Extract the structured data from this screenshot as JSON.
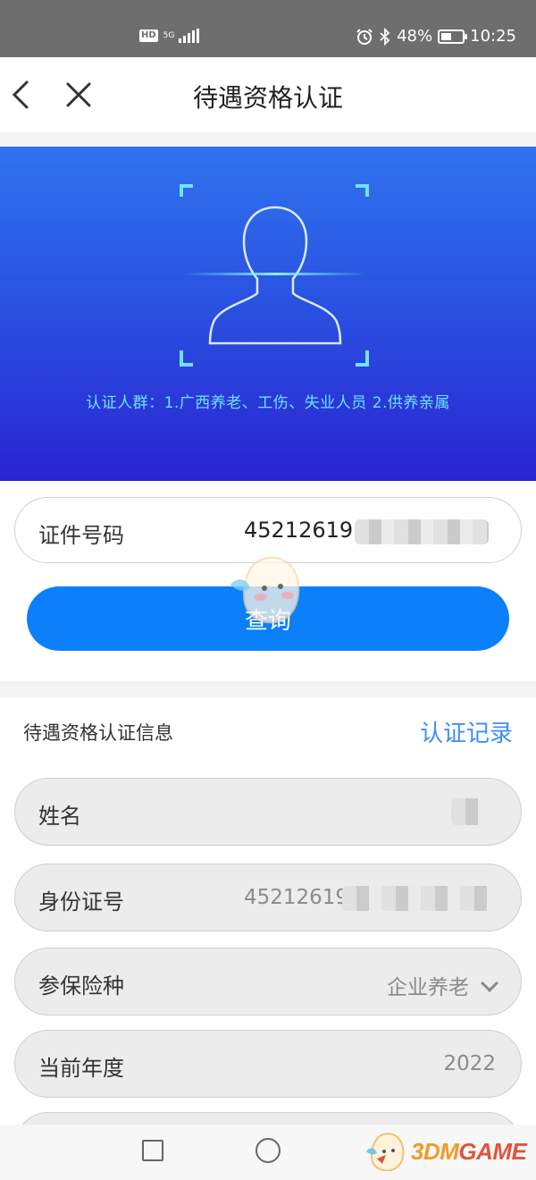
{
  "statusbar": {
    "hd": "HD",
    "net_top": "5G",
    "net_bottom": "ıl",
    "battery_text": "48%",
    "battery_level": 0.48,
    "time": "10:25",
    "icons": [
      "alarm-icon",
      "bluetooth-icon",
      "battery-icon",
      "signal-icon"
    ]
  },
  "navbar": {
    "title": "待遇资格认证",
    "back_icon": "chevron-left-icon",
    "close_icon": "close-icon"
  },
  "banner": {
    "text": "认证人群：1.广西养老、工伤、失业人员    2.供养亲属",
    "icon": "face-scan-icon"
  },
  "query": {
    "id_label": "证件号码",
    "id_value_visible": "45212619",
    "button_label": "查询"
  },
  "info": {
    "section_title": "待遇资格认证信息",
    "record_link": "认证记录",
    "fields": [
      {
        "label": "姓名",
        "value": ""
      },
      {
        "label": "身份证号",
        "value": "45212619"
      },
      {
        "label": "参保险种",
        "value": "企业养老"
      },
      {
        "label": "当前年度",
        "value": "2022"
      }
    ]
  },
  "bottom_nav": {
    "icons": [
      "recent-apps-square-icon",
      "home-circle-icon"
    ]
  },
  "watermark": {
    "prefix": "3DM",
    "suffix": "GAME"
  },
  "colors": {
    "primary": "#0c7ffa",
    "link": "#3c8ff5",
    "banner_top": "#2f73ee",
    "banner_bottom": "#2a24d2",
    "banner_text": "#6fe2ff",
    "statusbar": "#6e6e6e"
  }
}
